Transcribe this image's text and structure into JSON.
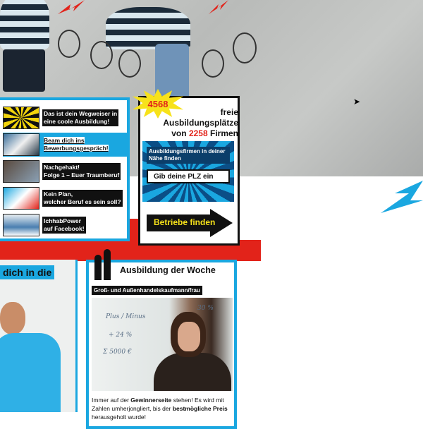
{
  "videos": [
    {
      "title": "Das ist dein Wegweiser in\neine coole Ausbildung!",
      "active": false
    },
    {
      "title": "Beam dich ins\nBewerbungsgespräch!",
      "active": true
    },
    {
      "title": "Nachgehakt!\nFolge 1 – Euer Traumberuf",
      "active": false
    },
    {
      "title": "Kein Plan,\nwelcher Beruf es sein soll?",
      "active": false
    },
    {
      "title": "IchhabPower\nauf Facebook!",
      "active": false
    }
  ],
  "jobs": {
    "count": "4568",
    "line1": "freie",
    "line2": "Ausbildungsplätze",
    "line3_prefix": "von",
    "companies": "2258",
    "line3_suffix": "Firmen"
  },
  "search": {
    "label": "Ausbildungsfirmen in deiner Nähe finden",
    "placeholder": "Gib deine PLZ ein",
    "button": "Betriebe finden"
  },
  "left_teaser": {
    "title": "dich in die"
  },
  "week": {
    "title": "Ausbildung der Woche",
    "subtitle": "Groß- und Außenhandelskaufmann/frau",
    "text_pre": "Immer auf der ",
    "text_bold1": "Gewinnerseite",
    "text_mid": " stehen! Es wird mit Zahlen umherjongliert, bis der ",
    "text_bold2": "bestmögliche Preis",
    "text_post": " herausgeholt wurde!"
  },
  "colors": {
    "accent_blue": "#1aa7e0",
    "accent_red": "#e2231a",
    "accent_yellow": "#f7e21a"
  },
  "icons": [
    "cursor-icon",
    "starburst-badge",
    "arrow-icon"
  ]
}
